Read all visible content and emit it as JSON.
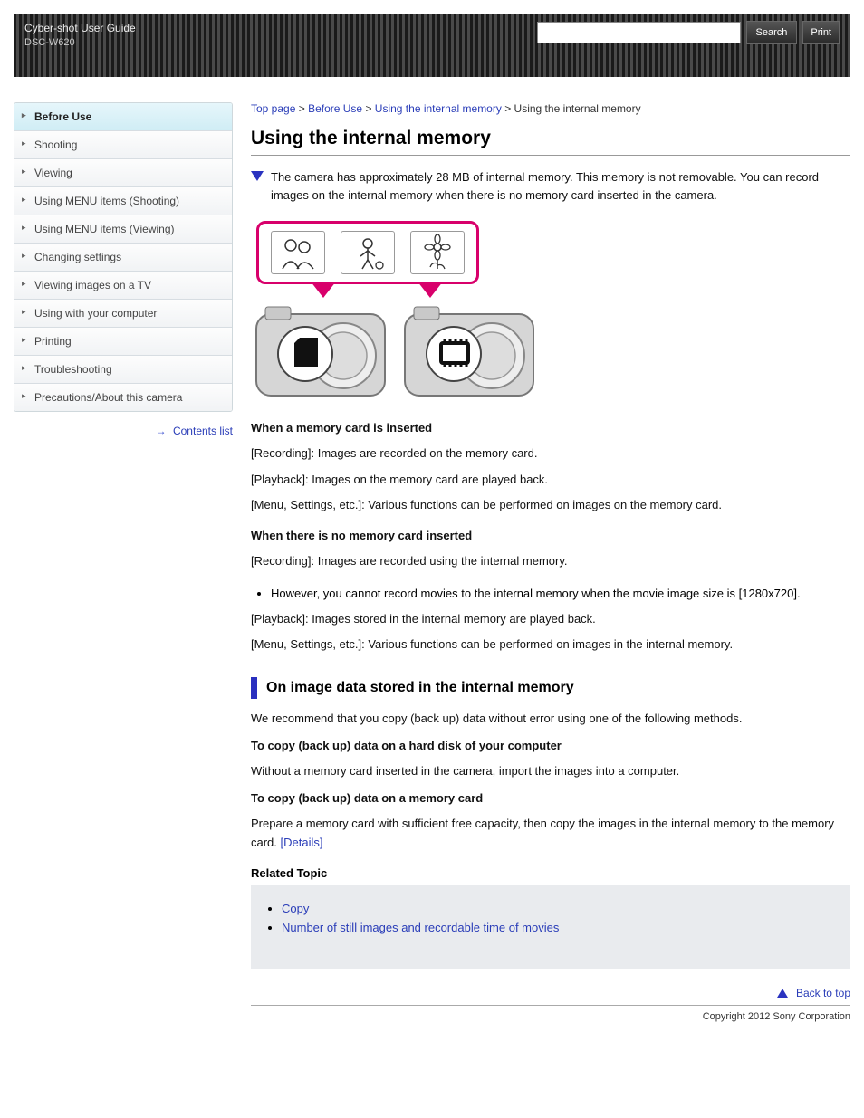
{
  "header": {
    "line1": "Cyber-shot User Guide",
    "line2": "DSC-W620",
    "search_placeholder": "",
    "search_button": "Search",
    "print_button": "Print"
  },
  "sidebar": {
    "items": [
      {
        "label": "Before Use",
        "active": true
      },
      {
        "label": "Shooting",
        "active": false
      },
      {
        "label": "Viewing",
        "active": false
      },
      {
        "label": "Using MENU items (Shooting)",
        "active": false
      },
      {
        "label": "Using MENU items (Viewing)",
        "active": false
      },
      {
        "label": "Changing settings",
        "active": false
      },
      {
        "label": "Viewing images on a TV",
        "active": false
      },
      {
        "label": "Using with your computer",
        "active": false
      },
      {
        "label": "Printing",
        "active": false
      },
      {
        "label": "Troubleshooting",
        "active": false
      },
      {
        "label": "Precautions/About this camera",
        "active": false
      }
    ],
    "print_link": "Contents list"
  },
  "breadcrumb": {
    "top": "Top page",
    "sep": " > ",
    "cat": "Before Use",
    "sub": "Using the internal memory",
    "leaf": "Using the internal memory"
  },
  "main": {
    "h1": "Using the internal memory",
    "para1": "The camera has approximately 28 MB of internal memory. This memory is not removable. You can record images on the internal memory when there is no memory card inserted in the camera.",
    "when_inserted_head": "When a memory card is inserted",
    "when_inserted_rec": "[Recording]: Images are recorded on the memory card.",
    "when_inserted_play": "[Playback]: Images on the memory card are played back.",
    "when_inserted_menu": "[Menu, Settings, etc.]: Various functions can be performed on images on the memory card.",
    "when_none_head": "When there is no memory card inserted",
    "when_none_rec": "[Recording]: Images are recorded using the internal memory.",
    "note_bullet": "However, you cannot record movies to the internal memory when the movie image size is [1280x720].",
    "when_none_play": "[Playback]: Images stored in the internal memory are played back.",
    "when_none_menu": "[Menu, Settings, etc.]: Various functions can be performed on images in the internal memory.",
    "subhead": "On image data stored in the internal memory",
    "subpara": "We recommend that you copy (back up) data without error using one of the following methods.",
    "backup_pc_head": "To copy (back up) data on a hard disk of your computer",
    "backup_pc_body": "Without a memory card inserted in the camera, import the images into a computer.",
    "backup_card_head": "To copy (back up) data on a memory card",
    "backup_card_body_pre": "Prepare a memory card with sufficient free capacity, then copy the images in the internal memory to the memory card. ",
    "backup_card_link": "[Details]",
    "related_title": "Related Topic",
    "related_items": [
      "Copy",
      "Number of still images and recordable time of movies"
    ],
    "back_top": "Back to top"
  },
  "footer": {
    "copyright": "Copyright 2012 Sony Corporation"
  }
}
